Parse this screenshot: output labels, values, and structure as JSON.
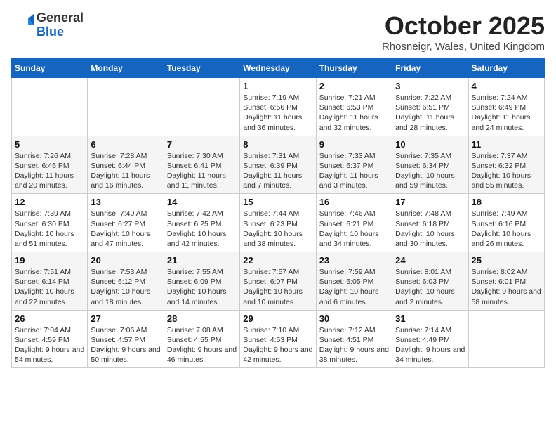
{
  "logo": {
    "general": "General",
    "blue": "Blue"
  },
  "title": "October 2025",
  "location": "Rhosneigr, Wales, United Kingdom",
  "days_of_week": [
    "Sunday",
    "Monday",
    "Tuesday",
    "Wednesday",
    "Thursday",
    "Friday",
    "Saturday"
  ],
  "weeks": [
    [
      {
        "day": "",
        "info": ""
      },
      {
        "day": "",
        "info": ""
      },
      {
        "day": "",
        "info": ""
      },
      {
        "day": "1",
        "info": "Sunrise: 7:19 AM\nSunset: 6:56 PM\nDaylight: 11 hours and 36 minutes."
      },
      {
        "day": "2",
        "info": "Sunrise: 7:21 AM\nSunset: 6:53 PM\nDaylight: 11 hours and 32 minutes."
      },
      {
        "day": "3",
        "info": "Sunrise: 7:22 AM\nSunset: 6:51 PM\nDaylight: 11 hours and 28 minutes."
      },
      {
        "day": "4",
        "info": "Sunrise: 7:24 AM\nSunset: 6:49 PM\nDaylight: 11 hours and 24 minutes."
      }
    ],
    [
      {
        "day": "5",
        "info": "Sunrise: 7:26 AM\nSunset: 6:46 PM\nDaylight: 11 hours and 20 minutes."
      },
      {
        "day": "6",
        "info": "Sunrise: 7:28 AM\nSunset: 6:44 PM\nDaylight: 11 hours and 16 minutes."
      },
      {
        "day": "7",
        "info": "Sunrise: 7:30 AM\nSunset: 6:41 PM\nDaylight: 11 hours and 11 minutes."
      },
      {
        "day": "8",
        "info": "Sunrise: 7:31 AM\nSunset: 6:39 PM\nDaylight: 11 hours and 7 minutes."
      },
      {
        "day": "9",
        "info": "Sunrise: 7:33 AM\nSunset: 6:37 PM\nDaylight: 11 hours and 3 minutes."
      },
      {
        "day": "10",
        "info": "Sunrise: 7:35 AM\nSunset: 6:34 PM\nDaylight: 10 hours and 59 minutes."
      },
      {
        "day": "11",
        "info": "Sunrise: 7:37 AM\nSunset: 6:32 PM\nDaylight: 10 hours and 55 minutes."
      }
    ],
    [
      {
        "day": "12",
        "info": "Sunrise: 7:39 AM\nSunset: 6:30 PM\nDaylight: 10 hours and 51 minutes."
      },
      {
        "day": "13",
        "info": "Sunrise: 7:40 AM\nSunset: 6:27 PM\nDaylight: 10 hours and 47 minutes."
      },
      {
        "day": "14",
        "info": "Sunrise: 7:42 AM\nSunset: 6:25 PM\nDaylight: 10 hours and 42 minutes."
      },
      {
        "day": "15",
        "info": "Sunrise: 7:44 AM\nSunset: 6:23 PM\nDaylight: 10 hours and 38 minutes."
      },
      {
        "day": "16",
        "info": "Sunrise: 7:46 AM\nSunset: 6:21 PM\nDaylight: 10 hours and 34 minutes."
      },
      {
        "day": "17",
        "info": "Sunrise: 7:48 AM\nSunset: 6:18 PM\nDaylight: 10 hours and 30 minutes."
      },
      {
        "day": "18",
        "info": "Sunrise: 7:49 AM\nSunset: 6:16 PM\nDaylight: 10 hours and 26 minutes."
      }
    ],
    [
      {
        "day": "19",
        "info": "Sunrise: 7:51 AM\nSunset: 6:14 PM\nDaylight: 10 hours and 22 minutes."
      },
      {
        "day": "20",
        "info": "Sunrise: 7:53 AM\nSunset: 6:12 PM\nDaylight: 10 hours and 18 minutes."
      },
      {
        "day": "21",
        "info": "Sunrise: 7:55 AM\nSunset: 6:09 PM\nDaylight: 10 hours and 14 minutes."
      },
      {
        "day": "22",
        "info": "Sunrise: 7:57 AM\nSunset: 6:07 PM\nDaylight: 10 hours and 10 minutes."
      },
      {
        "day": "23",
        "info": "Sunrise: 7:59 AM\nSunset: 6:05 PM\nDaylight: 10 hours and 6 minutes."
      },
      {
        "day": "24",
        "info": "Sunrise: 8:01 AM\nSunset: 6:03 PM\nDaylight: 10 hours and 2 minutes."
      },
      {
        "day": "25",
        "info": "Sunrise: 8:02 AM\nSunset: 6:01 PM\nDaylight: 9 hours and 58 minutes."
      }
    ],
    [
      {
        "day": "26",
        "info": "Sunrise: 7:04 AM\nSunset: 4:59 PM\nDaylight: 9 hours and 54 minutes."
      },
      {
        "day": "27",
        "info": "Sunrise: 7:06 AM\nSunset: 4:57 PM\nDaylight: 9 hours and 50 minutes."
      },
      {
        "day": "28",
        "info": "Sunrise: 7:08 AM\nSunset: 4:55 PM\nDaylight: 9 hours and 46 minutes."
      },
      {
        "day": "29",
        "info": "Sunrise: 7:10 AM\nSunset: 4:53 PM\nDaylight: 9 hours and 42 minutes."
      },
      {
        "day": "30",
        "info": "Sunrise: 7:12 AM\nSunset: 4:51 PM\nDaylight: 9 hours and 38 minutes."
      },
      {
        "day": "31",
        "info": "Sunrise: 7:14 AM\nSunset: 4:49 PM\nDaylight: 9 hours and 34 minutes."
      },
      {
        "day": "",
        "info": ""
      }
    ]
  ]
}
